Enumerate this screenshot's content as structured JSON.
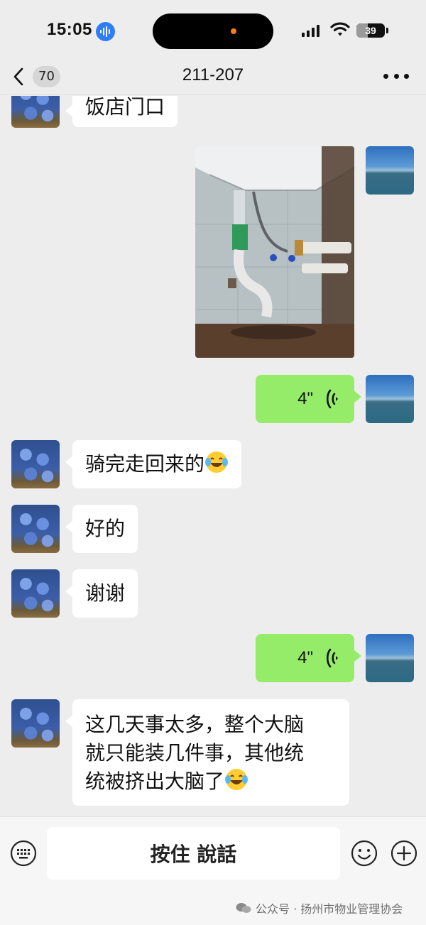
{
  "status_bar": {
    "time": "15:05",
    "battery": "39",
    "icons": [
      "siri-wave-icon",
      "cellular-signal-icon",
      "wifi-icon",
      "battery-icon"
    ]
  },
  "nav": {
    "back_icon": "chevron-left-icon",
    "unread_count": "70",
    "title": "211-207",
    "more_icon": "ellipsis-icon"
  },
  "messages": [
    {
      "side": "left",
      "type": "text",
      "text": "饭店门口"
    },
    {
      "side": "right",
      "type": "image"
    },
    {
      "side": "right",
      "type": "voice",
      "duration": "4\""
    },
    {
      "side": "left",
      "type": "text",
      "text": "骑完走回来的",
      "emoji": "tears-of-joy-emoji"
    },
    {
      "side": "left",
      "type": "text",
      "text": "好的"
    },
    {
      "side": "left",
      "type": "text",
      "text": "谢谢"
    },
    {
      "side": "right",
      "type": "voice",
      "duration": "4\""
    },
    {
      "side": "left",
      "type": "text",
      "lines": [
        "这几天事太多，整个大脑",
        "就只能装几件事，其他统",
        "统被挤出大脑了"
      ],
      "emoji": "tears-of-joy-emoji"
    }
  ],
  "input_bar": {
    "talk_label": "按住 說話",
    "icons": [
      "keyboard-icon",
      "emoji-face-icon",
      "plus-icon"
    ]
  },
  "watermark": {
    "text": "公众号 · 扬州市物业管理协会"
  },
  "colors": {
    "background": "#ededed",
    "bubble_self": "#95ec69",
    "bubble_other": "#ffffff"
  }
}
